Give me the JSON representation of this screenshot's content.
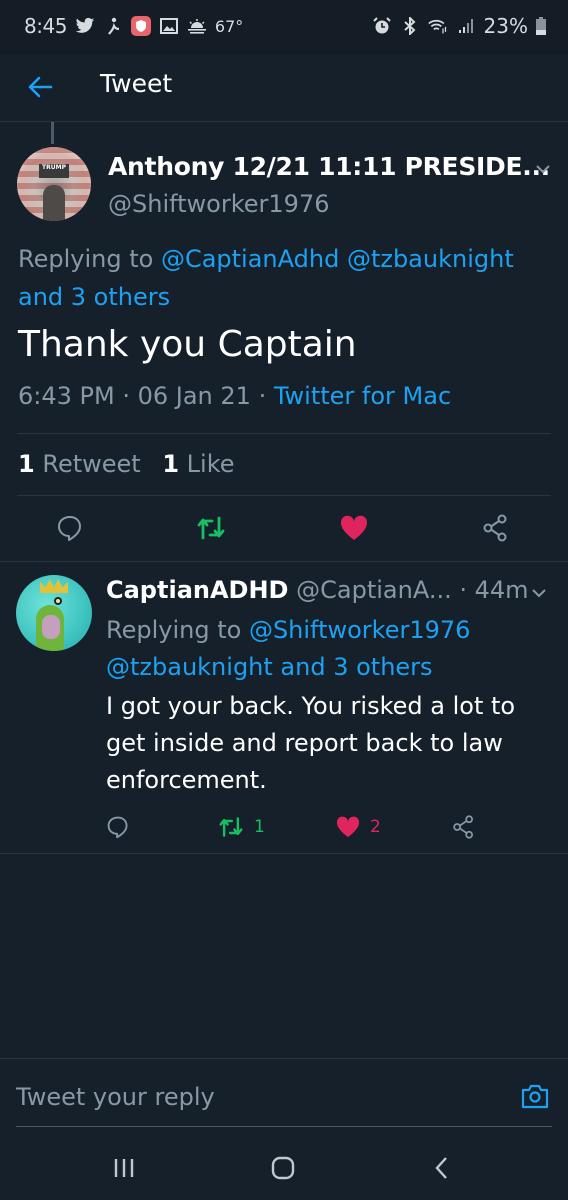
{
  "status_bar": {
    "time": "8:45",
    "left_icons": [
      "twitter-icon",
      "runner-app-icon",
      "shield-app-icon",
      "gallery-icon",
      "weather-sun-icon"
    ],
    "temperature": "67°",
    "right_icons": [
      "alarm-icon",
      "bluetooth-icon",
      "wifi-icon",
      "signal-icon"
    ],
    "battery_percent": "23%"
  },
  "header": {
    "back_icon": "arrow-left-icon",
    "title": "Tweet"
  },
  "main_tweet": {
    "author_name": "Anthony 12/21 11:11 PRESIDE...",
    "author_handle": "@Shiftworker1976",
    "replying_prefix": "Replying to ",
    "replying_mentions": "@CaptianAdhd @tzbauknight",
    "replying_others": "and 3 others",
    "text": "Thank you Captain",
    "time": "6:43 PM",
    "date": "06 Jan 21",
    "separator": " · ",
    "source": "Twitter for Mac",
    "retweet_count": "1",
    "retweet_label": "Retweet",
    "like_count": "1",
    "like_label": "Like",
    "retweeted": true,
    "liked": true
  },
  "reply": {
    "author_name": "CaptianADHD",
    "author_handle": "@CaptianA...",
    "time_ago": "· 44m",
    "replying_prefix": "Replying to ",
    "replying_mention_1": "@Shiftworker1976",
    "replying_rest": "@tzbauknight and 3 others",
    "text": "I got your back.  You risked a lot to get inside and report back to law enforcement.",
    "retweet_count": "1",
    "like_count": "2"
  },
  "composer": {
    "placeholder": "Tweet your reply",
    "camera_icon": "camera-icon"
  },
  "colors": {
    "background": "#15202b",
    "accent_blue": "#1da1f2",
    "retweet_green": "#17bf63",
    "like_pink": "#e0245e",
    "secondary_text": "#8899a6"
  },
  "nav_bar": {
    "buttons": [
      "recent-apps",
      "home",
      "back"
    ]
  }
}
